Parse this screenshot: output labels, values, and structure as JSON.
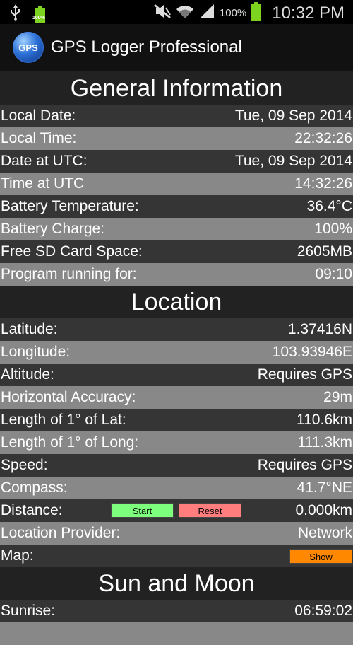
{
  "status_bar": {
    "battery_small_label": "100%",
    "battery_percent": "100%",
    "time": "10:32 PM"
  },
  "app": {
    "logo_text": "GPS",
    "title": "GPS Logger Professional"
  },
  "general": {
    "header": "General Information",
    "rows": [
      {
        "label": "Local Date:",
        "value": "Tue, 09 Sep 2014"
      },
      {
        "label": "Local Time:",
        "value": "22:32:26"
      },
      {
        "label": "Date at UTC:",
        "value": "Tue, 09 Sep 2014"
      },
      {
        "label": "Time at UTC",
        "value": "14:32:26"
      },
      {
        "label": "Battery Temperature:",
        "value": "36.4°C"
      },
      {
        "label": "Battery Charge:",
        "value": "100%"
      },
      {
        "label": "Free SD Card Space:",
        "value": "2605MB"
      },
      {
        "label": "Program running for:",
        "value": "09:10"
      }
    ]
  },
  "location": {
    "header": "Location",
    "rows": [
      {
        "label": "Latitude:",
        "value": "1.37416N"
      },
      {
        "label": "Longitude:",
        "value": "103.93946E"
      },
      {
        "label": "Altitude:",
        "value": "Requires GPS"
      },
      {
        "label": "Horizontal Accuracy:",
        "value": "29m"
      },
      {
        "label": "Length of 1° of Lat:",
        "value": "110.6km"
      },
      {
        "label": "Length of 1° of Long:",
        "value": "111.3km"
      },
      {
        "label": "Speed:",
        "value": "Requires GPS"
      },
      {
        "label": "Compass:",
        "value": "41.7°NE"
      }
    ],
    "distance": {
      "label": "Distance:",
      "start_label": "Start",
      "reset_label": "Reset",
      "value": "0.000km"
    },
    "provider": {
      "label": "Location Provider:",
      "value": "Network"
    },
    "map": {
      "label": "Map:",
      "show_label": "Show"
    }
  },
  "sun_moon": {
    "header": "Sun and Moon",
    "rows": [
      {
        "label": "Sunrise:",
        "value": "06:59:02"
      }
    ]
  }
}
